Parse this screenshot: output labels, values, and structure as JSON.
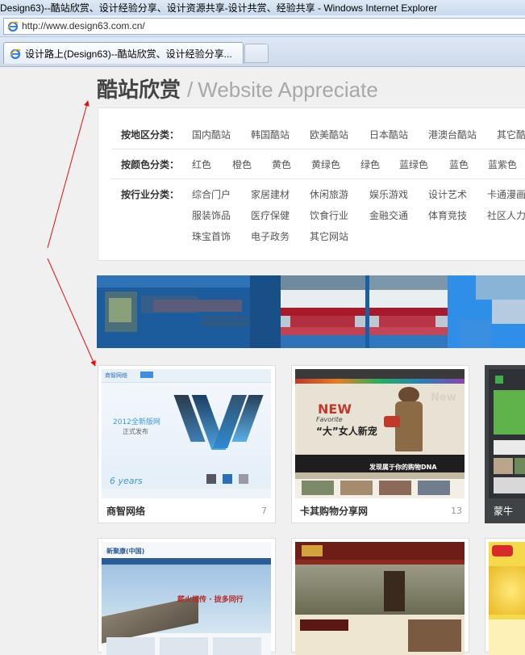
{
  "window": {
    "title": "Design63)--酷站欣赏、设计经验分享、设计资源共享-设计共赏、经验共享 - Windows Internet Explorer"
  },
  "address_bar": {
    "url": "http://www.design63.com.cn/",
    "icon": "ie-icon"
  },
  "tab": {
    "label": "设计路上(Design63)--酷站欣赏、设计经验分享...",
    "icon": "ie-icon"
  },
  "heading": {
    "cn": "酷站欣赏",
    "sep": "/",
    "en": "Website Appreciate"
  },
  "categories": [
    {
      "label": "按地区分类：",
      "items": [
        "国内酷站",
        "韩国酷站",
        "欧美酷站",
        "日本酷站",
        "港澳台酷站",
        "其它酷"
      ]
    },
    {
      "label": "按颜色分类：",
      "items": [
        "红色",
        "橙色",
        "黄色",
        "黄绿色",
        "绿色",
        "蓝绿色",
        "蓝色",
        "蓝紫色"
      ]
    },
    {
      "label": "按行业分类：",
      "items": [
        "综合门户",
        "家居建材",
        "休闲旅游",
        "娱乐游戏",
        "设计艺术",
        "卡通漫画",
        "服装饰品",
        "医疗保健",
        "饮食行业",
        "金融交通",
        "体育竞技",
        "社区人力",
        "珠宝首饰",
        "电子政务",
        "其它网站"
      ]
    }
  ],
  "cards": [
    {
      "name": "商智网络",
      "count": "7"
    },
    {
      "name": "卡其购物分享网",
      "count": "13"
    },
    {
      "name": "蒙牛",
      "count": ""
    }
  ],
  "thumb_text": {
    "card1_logo": "商智网络",
    "card1_year": "2012全新版网",
    "card1_release": "正式发布",
    "card1_years": "6 years",
    "card2_new": "NEW",
    "card2_fav": "Favorite",
    "card2_slogan": "“大”女人新宠",
    "card2_new2": "New",
    "card2_dna": "发现属于你的购物DNA",
    "card4_logo": "新聚康(中国)",
    "card4_slogan": "薪火相传 · 拢多同行"
  },
  "colors": {
    "page_bg": "#f0f0f0",
    "annotation_arrow": "#e01010",
    "banner_blue": "#1f5f9f",
    "banner_red": "#b02030"
  }
}
